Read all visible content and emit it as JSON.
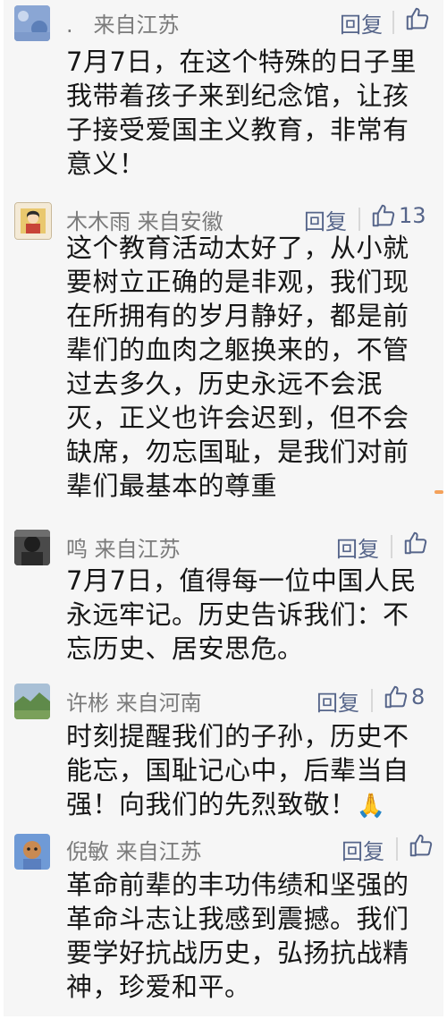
{
  "comments": [
    {
      "name": ".",
      "location": "来自江苏",
      "reply": "回复",
      "likes": "",
      "lines": [
        "7月7日，在这个特殊的日子里",
        "我带着孩子来到纪念馆，让孩",
        "子接受爱国主义教育，非常有",
        "意义！"
      ]
    },
    {
      "name": "木木雨",
      "location": "来自安徽",
      "reply": "回复",
      "likes": "13",
      "lines": [
        "这个教育活动太好了，从小就",
        "要树立正确的是非观，我们现",
        "在所拥有的岁月静好，都是前",
        "辈们的血肉之躯换来的，不管",
        "过去多久，历史永远不会泯",
        "灭，正义也许会迟到，但不会",
        "缺席，勿忘国耻，是我们对前",
        "辈们最基本的尊重"
      ]
    },
    {
      "name": "鸣",
      "location": "来自江苏",
      "reply": "回复",
      "likes": "",
      "lines": [
        "7月7日，值得每一位中国人民",
        "永远牢记。历史告诉我们：不",
        "忘历史、居安思危。"
      ]
    },
    {
      "name": "许彬",
      "location": "来自河南",
      "reply": "回复",
      "likes": "8",
      "lines": [
        "时刻提醒我们的子孙，历史不",
        "能忘，国耻记心中，后辈当自",
        "强！向我们的先烈致敬！"
      ],
      "emoji": "🙏"
    },
    {
      "name": "倪敏",
      "location": "来自江苏",
      "reply": "回复",
      "likes": "",
      "lines": [
        "革命前辈的丰功伟绩和坚强的",
        "革命斗志让我感到震撼。我们",
        "要学好抗战历史，弘扬抗战精",
        "神，珍爱和平。"
      ]
    }
  ]
}
